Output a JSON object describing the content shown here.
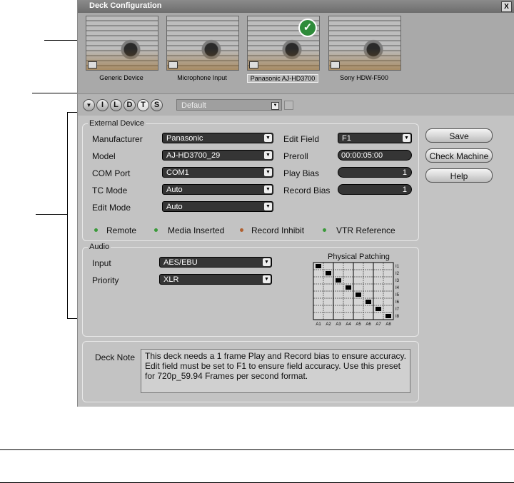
{
  "window": {
    "title": "Deck Configuration",
    "close_label": "X"
  },
  "devices": [
    {
      "label": "Generic Device",
      "selected": false
    },
    {
      "label": "Microphone Input",
      "selected": false
    },
    {
      "label": "Panasonic AJ-HD3700",
      "selected": true
    },
    {
      "label": "Sony HDW-F500",
      "selected": false
    }
  ],
  "toolbar": {
    "buttons": [
      "▼",
      "I",
      "L",
      "D",
      "T",
      "S"
    ],
    "preset_value": "Default",
    "dropdown_arrow": "▼"
  },
  "external_device": {
    "title": "External Device",
    "manufacturer": {
      "label": "Manufacturer",
      "value": "Panasonic"
    },
    "model": {
      "label": "Model",
      "value": "AJ-HD3700_29"
    },
    "com_port": {
      "label": "COM Port",
      "value": "COM1"
    },
    "tc_mode": {
      "label": "TC Mode",
      "value": "Auto"
    },
    "edit_mode": {
      "label": "Edit Mode",
      "value": "Auto"
    },
    "edit_field": {
      "label": "Edit Field",
      "value": "F1"
    },
    "preroll": {
      "label": "Preroll",
      "value": "00:00:05:00"
    },
    "play_bias": {
      "label": "Play Bias",
      "value": "1"
    },
    "record_bias": {
      "label": "Record Bias",
      "value": "1"
    },
    "indicators": [
      {
        "label": "Remote",
        "color": "#3a9a3a"
      },
      {
        "label": "Media Inserted",
        "color": "#3a9a3a"
      },
      {
        "label": "Record Inhibit",
        "color": "#b06030"
      },
      {
        "label": "VTR Reference",
        "color": "#3a9a3a"
      }
    ]
  },
  "buttons": {
    "save": "Save",
    "check_machine": "Check Machine",
    "help": "Help"
  },
  "audio": {
    "title": "Audio",
    "input": {
      "label": "Input",
      "value": "AES/EBU"
    },
    "priority": {
      "label": "Priority",
      "value": "XLR"
    },
    "patching": {
      "title": "Physical Patching",
      "cols": [
        "A1",
        "A2",
        "A3",
        "A4",
        "A5",
        "A6",
        "A7",
        "A8"
      ],
      "rows": [
        "I1",
        "I2",
        "I3",
        "I4",
        "I5",
        "I6",
        "I7",
        "I8"
      ],
      "connections": [
        [
          0,
          0
        ],
        [
          1,
          1
        ],
        [
          2,
          2
        ],
        [
          3,
          3
        ],
        [
          4,
          4
        ],
        [
          5,
          5
        ],
        [
          6,
          6
        ],
        [
          7,
          7
        ]
      ]
    }
  },
  "deck_note": {
    "label": "Deck Note",
    "text": "This deck needs a 1 frame Play and Record bias to ensure accuracy. Edit field must be set to F1 to ensure field accuracy. Use this preset for 720p_59.94 Frames per second format."
  }
}
